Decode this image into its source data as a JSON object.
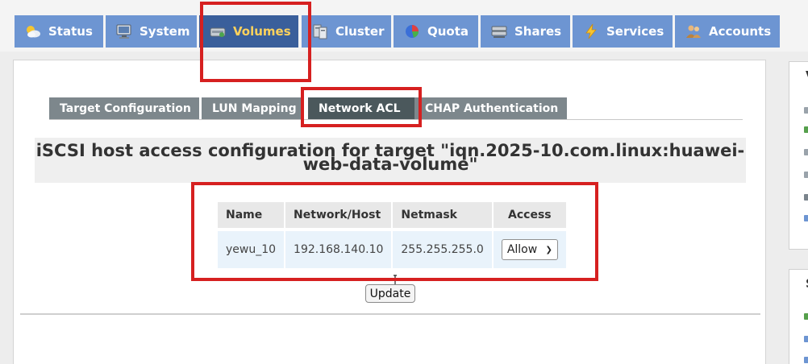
{
  "nav": {
    "tabs": [
      {
        "label": "Status",
        "icon": "weather-icon"
      },
      {
        "label": "System",
        "icon": "monitor-icon"
      },
      {
        "label": "Volumes",
        "icon": "drive-icon",
        "active": true
      },
      {
        "label": "Cluster",
        "icon": "server-icon"
      },
      {
        "label": "Quota",
        "icon": "pie-chart-icon"
      },
      {
        "label": "Shares",
        "icon": "share-drive-icon"
      },
      {
        "label": "Services",
        "icon": "lightning-icon"
      },
      {
        "label": "Accounts",
        "icon": "users-icon"
      }
    ]
  },
  "subtabs": [
    {
      "label": "Target Configuration"
    },
    {
      "label": "LUN Mapping"
    },
    {
      "label": "Network ACL",
      "active": true
    },
    {
      "label": "CHAP Authentication"
    }
  ],
  "page": {
    "title_line1": "iSCSI host access configuration for target \"iqn.2025-10.com.linux:huawei-",
    "title_line2": "web-data-volume\""
  },
  "acl_table": {
    "headers": [
      "Name",
      "Network/Host",
      "Netmask",
      "Access"
    ],
    "rows": [
      {
        "name": "yewu_10",
        "network": "192.168.140.10",
        "netmask": "255.255.255.0",
        "access": "Allow"
      }
    ]
  },
  "update_label": "Update",
  "sidebar": {
    "box1_caption": "V",
    "box2_caption": "S"
  },
  "colors": {
    "nav_tab": "#6d95d2",
    "nav_tab_active": "#3a5f9b",
    "nav_active_text": "#ffd25c",
    "subtab": "#7d878c",
    "subtab_active": "#4b585c",
    "highlight": "#d62020"
  }
}
